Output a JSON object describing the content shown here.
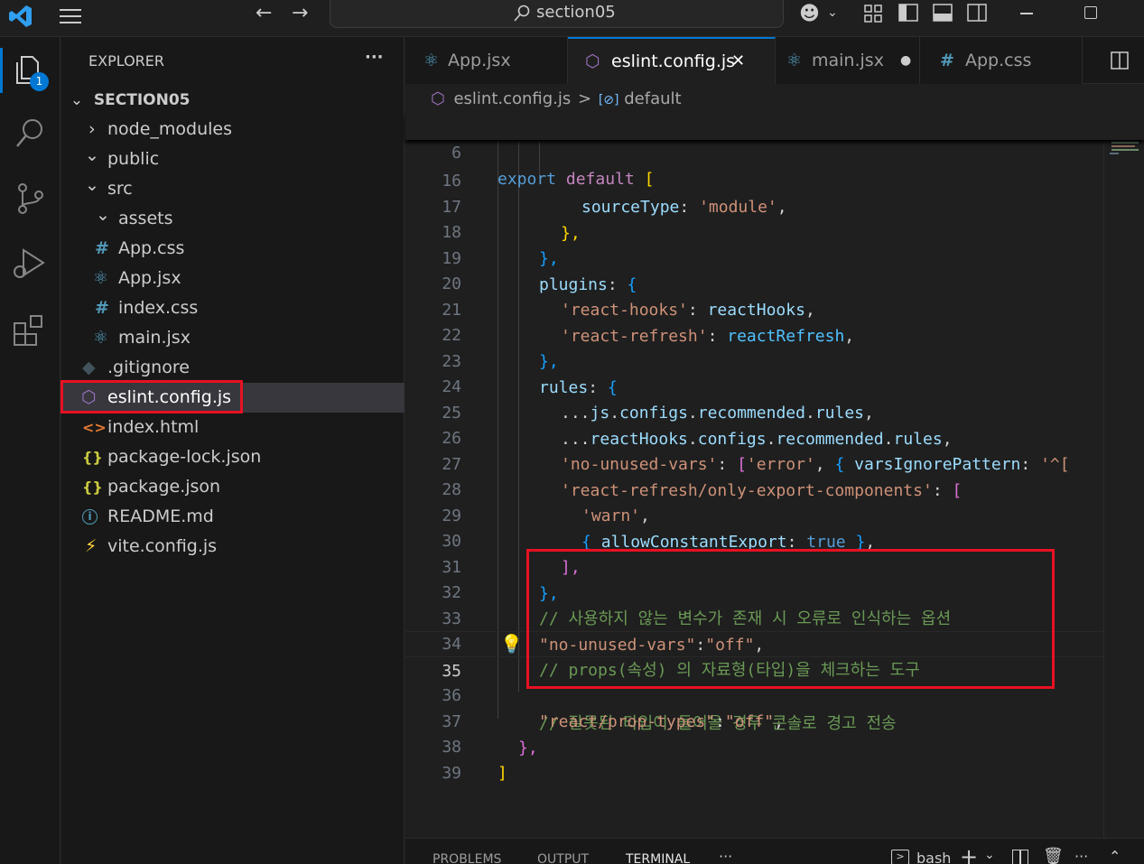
{
  "titlebar": {
    "search_text": "section05"
  },
  "activity": {
    "explorer_badge": "1"
  },
  "explorer": {
    "header": "EXPLORER",
    "more": "···",
    "project": "SECTION05",
    "items": [
      {
        "label": "node_modules",
        "icon": "chevron-right"
      },
      {
        "label": "public",
        "icon": "chevron-down"
      },
      {
        "label": "src",
        "icon": "chevron-down"
      },
      {
        "label": "assets",
        "icon": "chevron-down"
      },
      {
        "label": "App.css",
        "icon": "#"
      },
      {
        "label": "App.jsx",
        "icon": "react"
      },
      {
        "label": "index.css",
        "icon": "#"
      },
      {
        "label": "main.jsx",
        "icon": "react"
      },
      {
        "label": ".gitignore",
        "icon": "git"
      },
      {
        "label": "eslint.config.js",
        "icon": "eslint"
      },
      {
        "label": "index.html",
        "icon": "<>"
      },
      {
        "label": "package-lock.json",
        "icon": "{}"
      },
      {
        "label": "package.json",
        "icon": "{}"
      },
      {
        "label": "README.md",
        "icon": "info"
      },
      {
        "label": "vite.config.js",
        "icon": "bolt"
      }
    ]
  },
  "tabs": [
    {
      "label": "App.jsx"
    },
    {
      "label": "eslint.config.js",
      "close": "✕"
    },
    {
      "label": "main.jsx",
      "dot": "●"
    },
    {
      "label": "App.css"
    }
  ],
  "breadcrumb": {
    "file": "eslint.config.js",
    "symbol": "default",
    "sep": ">"
  },
  "sticky": {
    "num": "6",
    "code": "export default ["
  },
  "lines": [
    {
      "num": "16",
      "a": "sourceType",
      "b": "'module'"
    },
    {
      "num": "17",
      "a": "},"
    },
    {
      "num": "18",
      "a": "},"
    },
    {
      "num": "19",
      "a": "plugins",
      "b": "{"
    },
    {
      "num": "20",
      "a": "'react-hooks'",
      "b": "reactHooks"
    },
    {
      "num": "21",
      "a": "'react-refresh'",
      "b": "reactRefresh"
    },
    {
      "num": "22",
      "a": "},"
    },
    {
      "num": "23",
      "a": "rules",
      "b": "{"
    },
    {
      "num": "24",
      "a": "...",
      "b": "js",
      "c": "configs",
      "d": "recommended",
      "e": "rules"
    },
    {
      "num": "25",
      "a": "...",
      "b": "reactHooks",
      "c": "configs",
      "d": "recommended",
      "e": "rules"
    },
    {
      "num": "26",
      "a": "'no-unused-vars'",
      "b": "'error'",
      "c": "varsIgnorePattern",
      "d": "'^["
    },
    {
      "num": "27",
      "a": "'react-refresh/only-export-components'"
    },
    {
      "num": "28",
      "a": "'warn'"
    },
    {
      "num": "29",
      "a": "allowConstantExport",
      "b": "true"
    },
    {
      "num": "30",
      "a": "],"
    },
    {
      "num": "31",
      "a": "},"
    },
    {
      "num": "32",
      "a": "// 사용하지 않는 변수가 존재 시 오류로 인식하는 옵션"
    },
    {
      "num": "33",
      "a": "\"no-unused-vars\"",
      "b": "\"off\""
    },
    {
      "num": "34",
      "a": "// props(속성) 의 자료형(타입)을 체크하는 도구"
    },
    {
      "num": "35",
      "a": "// 잘못된 타입이 들어올 경우 콘솔로 경고 전송"
    },
    {
      "num": "36",
      "a": "\"react/prop-types\"",
      "b": "\"off\""
    },
    {
      "num": "37",
      "a": "},"
    },
    {
      "num": "38",
      "a": "]"
    },
    {
      "num": "39"
    }
  ],
  "panel": {
    "tabs": [
      "PROBLEMS",
      "OUTPUT",
      "TERMINAL"
    ],
    "more": "···",
    "shell": "bash"
  },
  "colors": {
    "highlight_box": "#e81123",
    "accent": "#0078d4"
  }
}
